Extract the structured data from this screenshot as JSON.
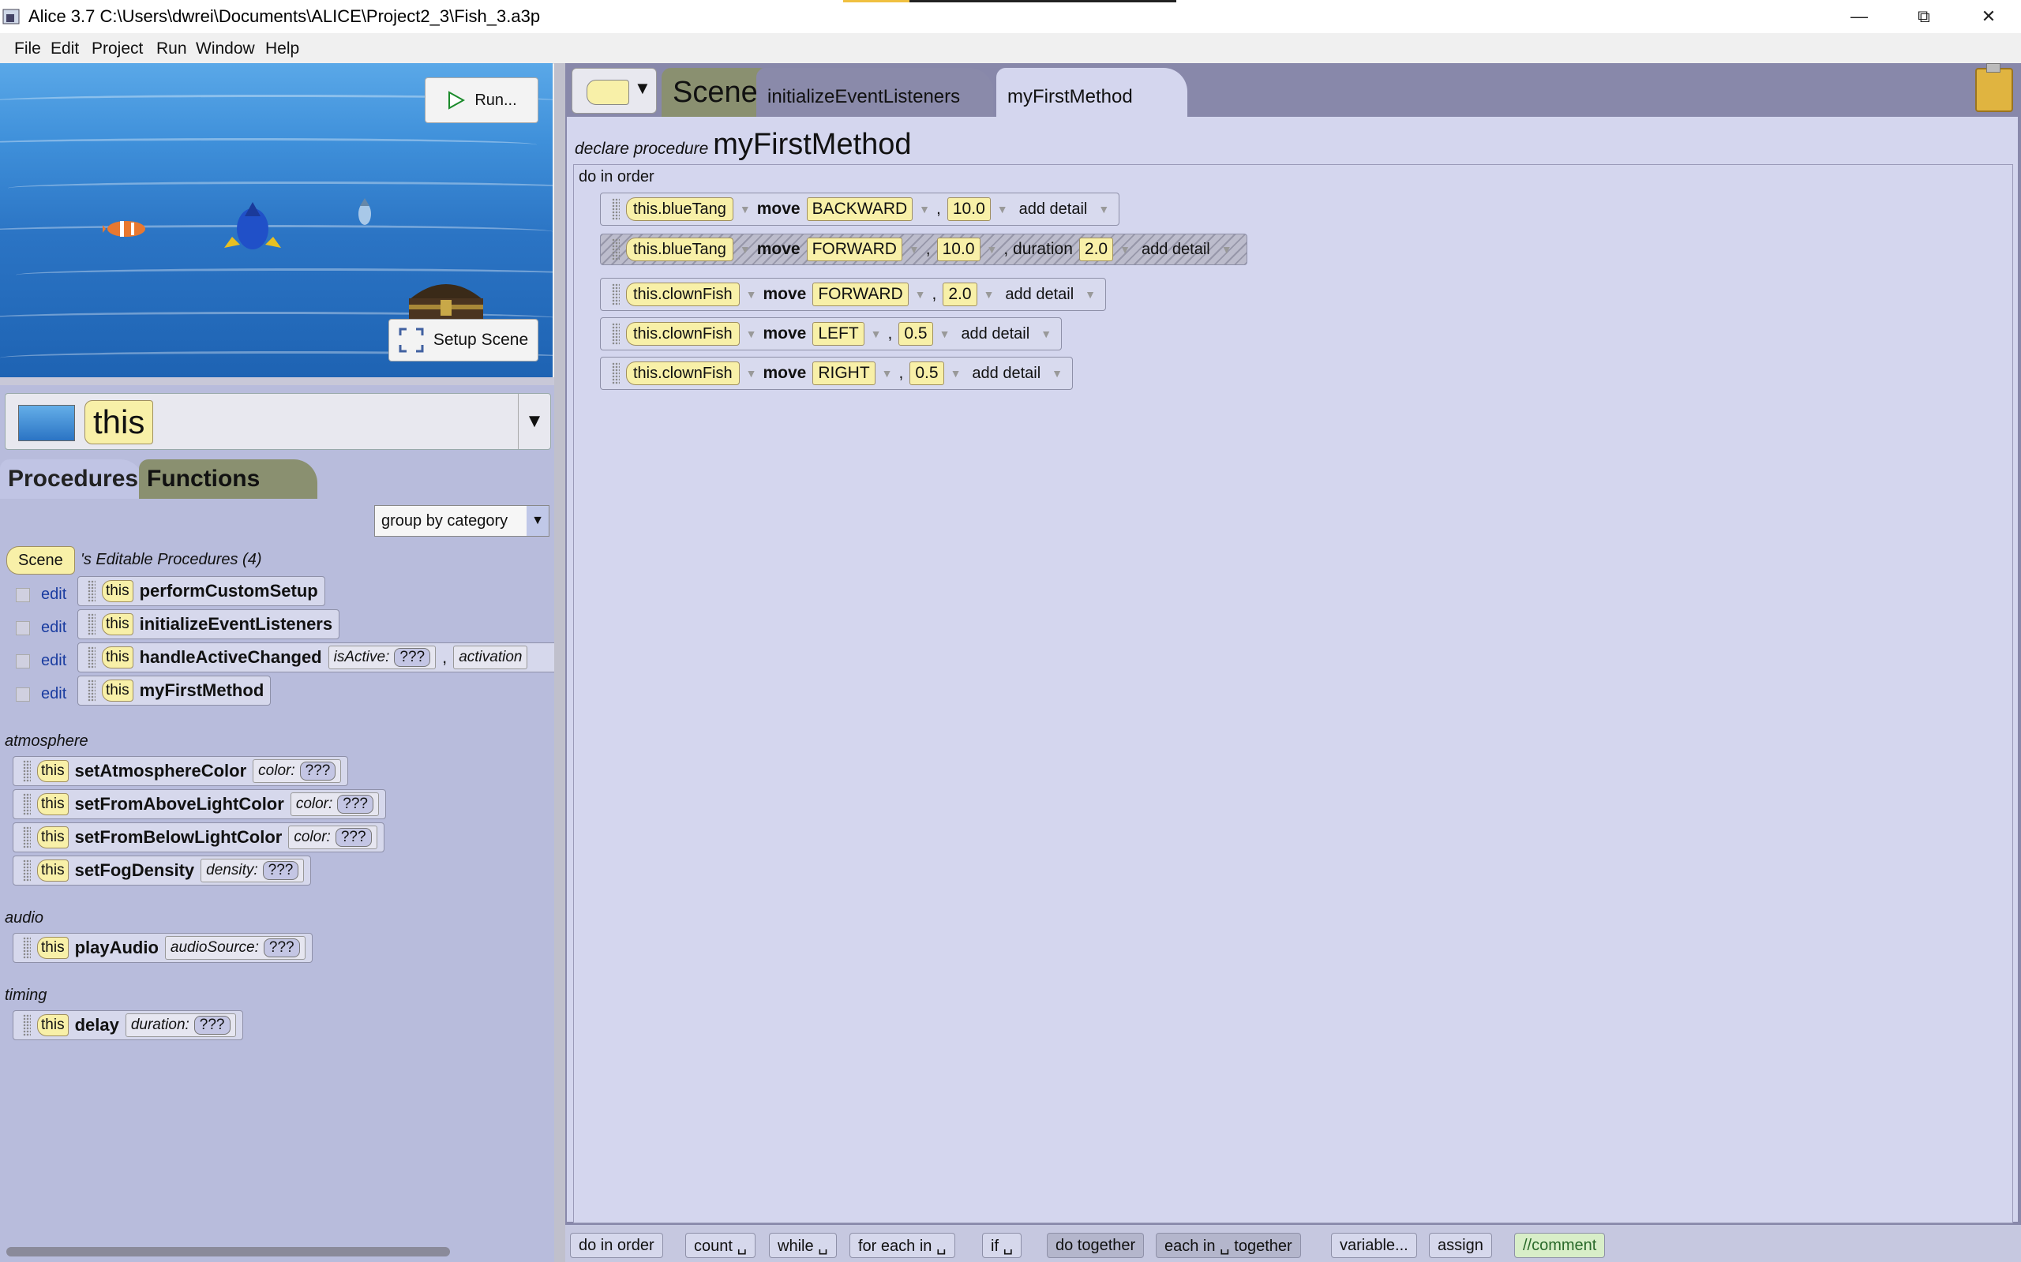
{
  "window": {
    "title": "Alice 3.7 C:\\Users\\dwrei\\Documents\\ALICE\\Project2_3\\Fish_3.a3p",
    "minimize_icon": "minimize-icon",
    "restore_icon": "restore-icon",
    "close_icon": "close-icon"
  },
  "menu": [
    "File",
    "Edit",
    "Project",
    "Run",
    "Window",
    "Help"
  ],
  "scene_view": {
    "run_label": "Run...",
    "setup_scene_label": "Setup Scene"
  },
  "instance": {
    "selected": "this"
  },
  "left_tabs": {
    "procedures": "Procedures",
    "functions": "Functions"
  },
  "group_by": "group by category",
  "editable": {
    "type": "Scene",
    "header": "'s Editable Procedures (4)",
    "edit_label": "edit",
    "this": "this",
    "items": [
      {
        "name": "performCustomSetup"
      },
      {
        "name": "initializeEventListeners"
      },
      {
        "name": "handleActiveChanged",
        "param1": "isActive:",
        "value1": "???",
        "sep": ",",
        "param2": "activation"
      },
      {
        "name": "myFirstMethod"
      }
    ]
  },
  "categories": [
    {
      "name": "atmosphere",
      "procs": [
        {
          "name": "setAtmosphereColor",
          "param": "color:",
          "value": "???"
        },
        {
          "name": "setFromAboveLightColor",
          "param": "color:",
          "value": "???"
        },
        {
          "name": "setFromBelowLightColor",
          "param": "color:",
          "value": "???"
        },
        {
          "name": "setFogDensity",
          "param": "density:",
          "value": "???"
        }
      ]
    },
    {
      "name": "audio",
      "procs": [
        {
          "name": "playAudio",
          "param": "audioSource:",
          "value": "???"
        }
      ]
    },
    {
      "name": "timing",
      "procs": [
        {
          "name": "delay",
          "param": "duration:",
          "value": "???"
        }
      ]
    }
  ],
  "editor_tabs": {
    "scene": "Scene",
    "init": "initializeEventListeners",
    "method": "myFirstMethod"
  },
  "declare": {
    "keyword": "declare procedure",
    "name": "myFirstMethod"
  },
  "do_in_order": "do in order",
  "statements": [
    {
      "obj": "this.blueTang",
      "verb": "move",
      "dir": "BACKWARD",
      "amount": "10.0",
      "add": "add detail"
    },
    {
      "obj": "this.blueTang",
      "verb": "move",
      "dir": "FORWARD",
      "amount": "10.0",
      "dur_label": ", duration",
      "dur": "2.0",
      "add": "add detail",
      "selected": true
    },
    {
      "obj": "this.clownFish",
      "verb": "move",
      "dir": "FORWARD",
      "amount": "2.0",
      "add": "add detail"
    },
    {
      "obj": "this.clownFish",
      "verb": "move",
      "dir": "LEFT",
      "amount": "0.5",
      "add": "add detail"
    },
    {
      "obj": "this.clownFish",
      "verb": "move",
      "dir": "RIGHT",
      "amount": "0.5",
      "add": "add detail"
    }
  ],
  "palette": [
    "do in order",
    "count ␣",
    "while ␣",
    "for each in ␣",
    "if ␣",
    "do together",
    "each in ␣ together",
    "variable...",
    "assign",
    "//comment"
  ],
  "colors": {
    "editor_bg": "#d4d6ee",
    "pill_yellow": "#f8f0a8",
    "left_bg": "#b8bcdc",
    "water": "#2b74c4"
  }
}
